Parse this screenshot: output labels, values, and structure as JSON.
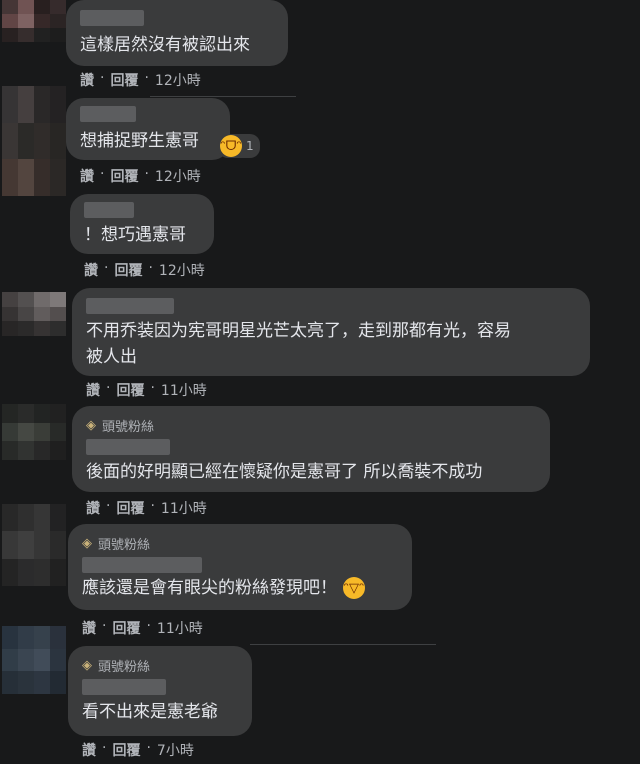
{
  "colors": {
    "background": "#18191a",
    "bubble": "#3a3b3c",
    "text": "#e4e6eb",
    "meta": "#b0b3b8",
    "reaction": "#f7b928",
    "badge": "#c9b27a"
  },
  "comments": [
    {
      "text": "這樣居然沒有被認出來",
      "like": "讚",
      "reply": "回覆",
      "time": "12小時"
    },
    {
      "text": "想捕捉野生憲哥",
      "like": "讚",
      "reply": "回覆",
      "time": "12小時",
      "reaction_count": "1",
      "reaction_icon": "laughing-emoji"
    },
    {
      "text": "！想巧遇憲哥",
      "like": "讚",
      "reply": "回覆",
      "time": "12小時"
    },
    {
      "text": "不用乔装因为宪哥明星光芒太亮了，走到那都有光，容易\n被人出",
      "like": "讚",
      "reply": "回覆",
      "time": "11小時"
    },
    {
      "badge": "頭號粉絲",
      "badge_icon": "diamond-icon",
      "text": "後面的好明顯已經在懷疑你是憲哥了 所以喬裝不成功",
      "like": "讚",
      "reply": "回覆",
      "time": "11小時"
    },
    {
      "badge": "頭號粉絲",
      "badge_icon": "diamond-icon",
      "text": "應該還是會有眼尖的粉絲發現吧！",
      "emoji_icon": "grinning-emoji",
      "like": "讚",
      "reply": "回覆",
      "time": "11小時"
    },
    {
      "badge": "頭號粉絲",
      "badge_icon": "diamond-icon",
      "text": "看不出來是憲老爺",
      "like": "讚",
      "reply": "回覆",
      "time": "7小時"
    }
  ]
}
